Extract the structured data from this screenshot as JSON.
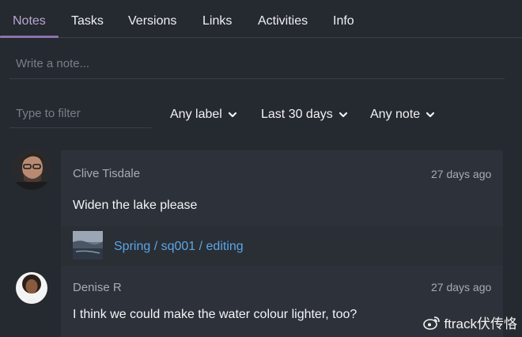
{
  "tabs": [
    {
      "label": "Notes"
    },
    {
      "label": "Tasks"
    },
    {
      "label": "Versions"
    },
    {
      "label": "Links"
    },
    {
      "label": "Activities"
    },
    {
      "label": "Info"
    }
  ],
  "note_input": {
    "placeholder": "Write a note..."
  },
  "filters": {
    "search_placeholder": "Type to filter",
    "label_dropdown": "Any label",
    "date_dropdown": "Last 30 days",
    "note_dropdown": "Any note"
  },
  "notes": [
    {
      "author": "Clive Tisdale",
      "time": "27 days ago",
      "text": "Widen the lake please",
      "attachment_link": "Spring / sq001 / editing"
    },
    {
      "author": "Denise R",
      "time": "27 days ago",
      "text": "I think we could make the water colour lighter, too?"
    }
  ],
  "watermark": {
    "text": "ftrack伏传恪",
    "icon": "weibo-icon"
  },
  "colors": {
    "background": "#252930",
    "card": "#2d323a",
    "active_tab": "#b9a7cf",
    "link": "#5aa6e6"
  }
}
